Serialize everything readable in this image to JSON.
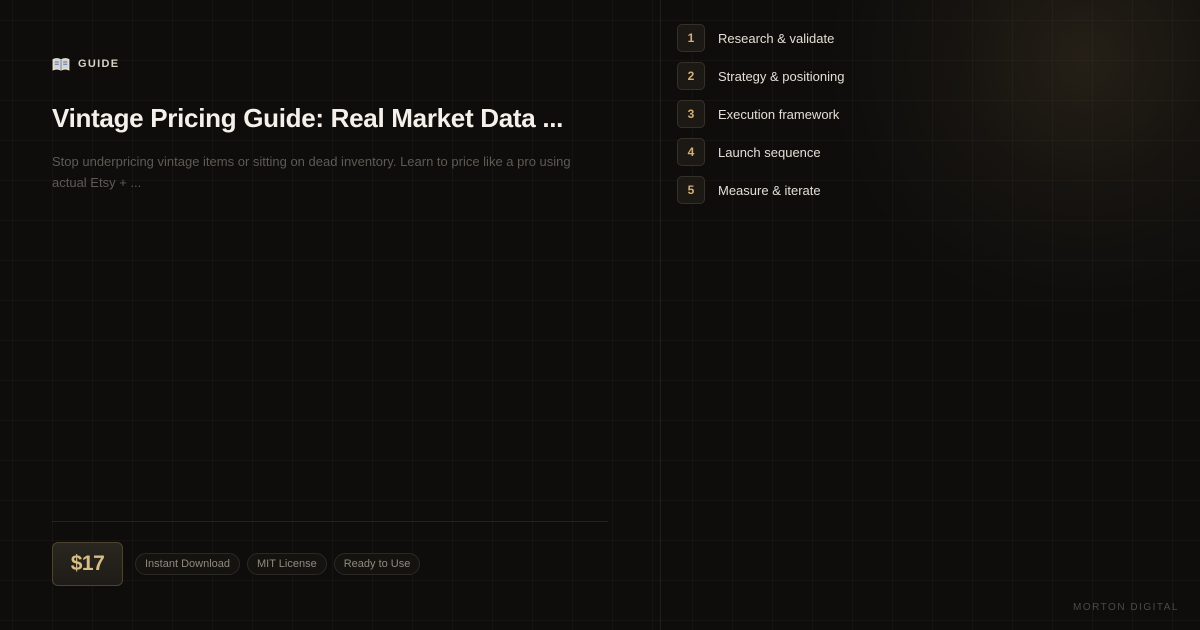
{
  "product": {
    "kind_icon": "open-book-icon",
    "kind_label": "GUIDE",
    "title": "Vintage Pricing Guide: Real Market Data ...",
    "description": "Stop underpricing vintage items or sitting on dead inventory. Learn to price like a pro using actual Etsy + ...",
    "price": "$17",
    "tags": [
      "Instant Download",
      "MIT License",
      "Ready to Use"
    ]
  },
  "steps": [
    {
      "number": "1",
      "label": "Research & validate"
    },
    {
      "number": "2",
      "label": "Strategy & positioning"
    },
    {
      "number": "3",
      "label": "Execution framework"
    },
    {
      "number": "4",
      "label": "Launch sequence"
    },
    {
      "number": "5",
      "label": "Measure & iterate"
    }
  ],
  "brand": "MORTON DIGITAL",
  "colors": {
    "background": "#0e0d0c",
    "accent": "#d2b077",
    "text": "#f5f1ea",
    "muted_text": "#5e5a54"
  }
}
